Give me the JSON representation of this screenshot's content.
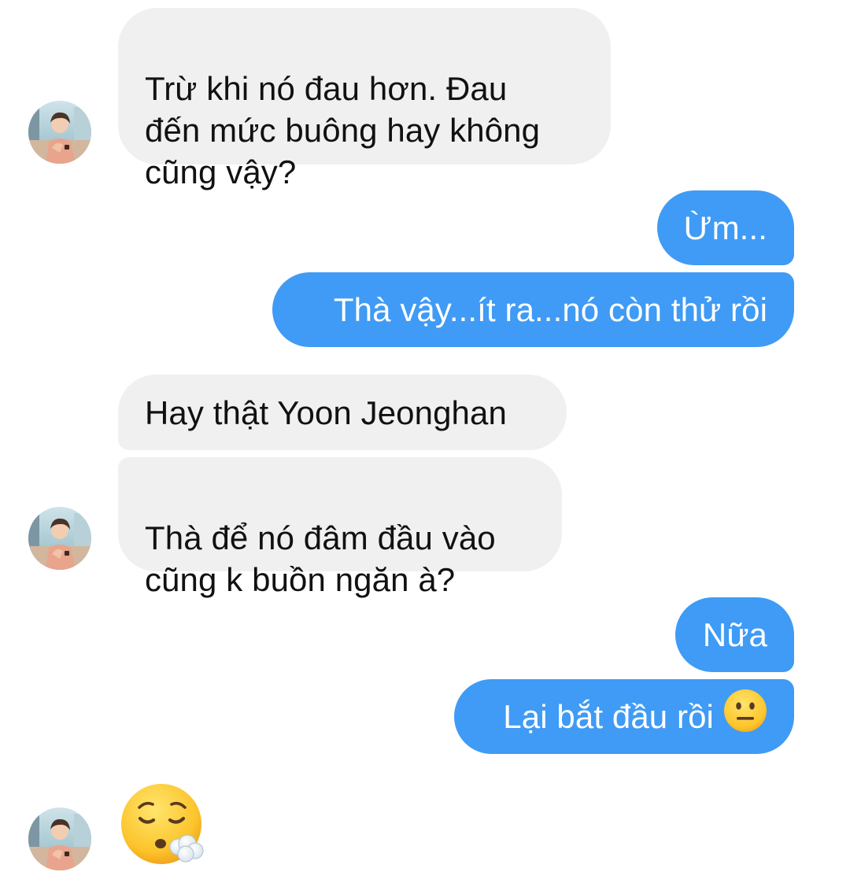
{
  "conversation": {
    "messages": [
      {
        "sender": "them",
        "text": "Trừ khi nó đau hơn. Đau\nđến mức buông hay không\ncũng vậy?"
      },
      {
        "sender": "me",
        "text": "Ừm..."
      },
      {
        "sender": "me",
        "text": "Thà vậy...ít ra...nó còn thử rồi"
      },
      {
        "sender": "them",
        "text": "Hay thật Yoon Jeonghan"
      },
      {
        "sender": "them",
        "text": "Thà để nó đâm đầu vào\ncũng k buồn ngăn à?"
      },
      {
        "sender": "me",
        "text": "Nữa"
      },
      {
        "sender": "me",
        "text": "Lại bắt đầu rồi",
        "emoji": "neutral-face-emoji"
      },
      {
        "sender": "them",
        "emoji": "sleepy-sigh-face-emoji"
      }
    ]
  },
  "colors": {
    "incoming_bubble": "#f0f0f0",
    "outgoing_bubble": "#3f9bf5",
    "incoming_text": "#111111",
    "outgoing_text": "#ffffff"
  }
}
